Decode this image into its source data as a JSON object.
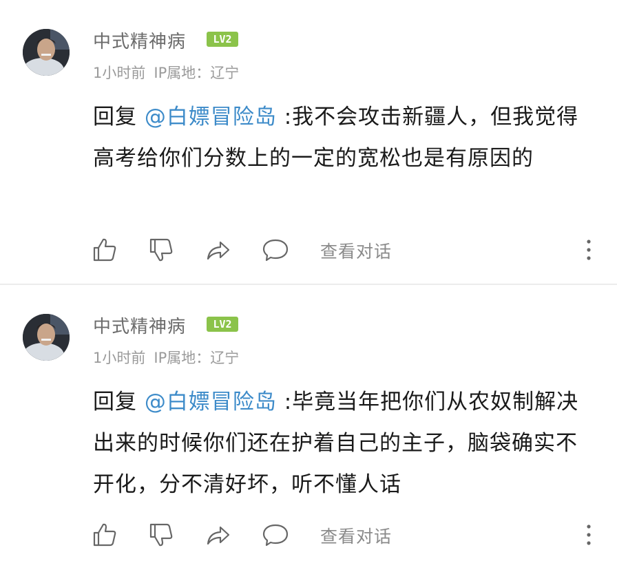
{
  "comments": [
    {
      "username": "中式精神病",
      "level": "LV2",
      "time": "1小时前",
      "ip_location": "IP属地：辽宁",
      "reply_prefix": "回复",
      "mention": "@白嫖冒险岛",
      "text": ":我不会攻击新疆人，但我觉得高考给你们分数上的一定的宽松也是有原因的",
      "view_conversation": "查看对话"
    },
    {
      "username": "中式精神病",
      "level": "LV2",
      "time": "1小时前",
      "ip_location": "IP属地：辽宁",
      "reply_prefix": "回复",
      "mention": "@白嫖冒险岛",
      "text": ":毕竟当年把你们从农奴制解决出来的时候你们还在护着自己的主子，脑袋确实不开化，分不清好坏，听不懂人话",
      "view_conversation": "查看对话"
    }
  ],
  "icons": {
    "like": "thumbs-up-icon",
    "dislike": "thumbs-down-icon",
    "share": "share-arrow-icon",
    "reply": "speech-bubble-icon",
    "more": "vertical-dots-icon"
  },
  "colors": {
    "mention": "#3d8bc9",
    "level_badge": "#8bc34a",
    "username": "#6b6b6b",
    "meta": "#9a9a9a"
  }
}
